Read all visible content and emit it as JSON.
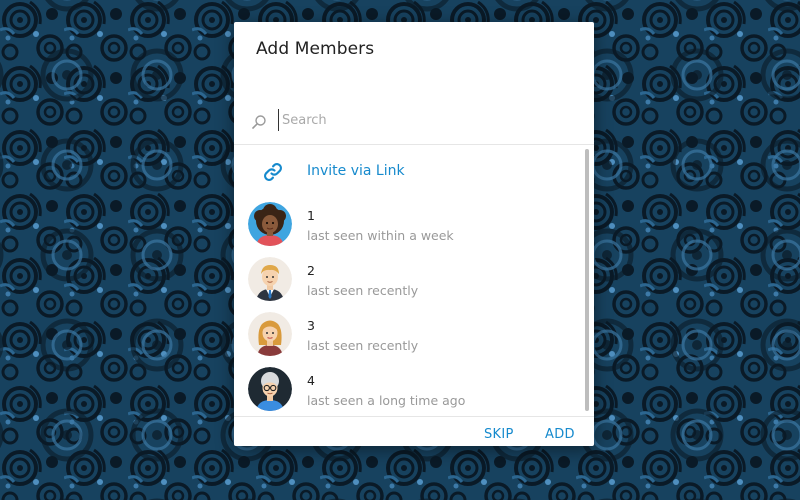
{
  "dialog": {
    "title": "Add Members",
    "search_placeholder": "Search",
    "invite_label": "Invite via Link",
    "skip_label": "SKIP",
    "add_label": "ADD"
  },
  "members": [
    {
      "name": "1",
      "status": "last seen within a week",
      "avatar": "woman-curly-hair-avatar"
    },
    {
      "name": "2",
      "status": "last seen recently",
      "avatar": "man-blonde-tie-avatar"
    },
    {
      "name": "3",
      "status": "last seen recently",
      "avatar": "woman-blonde-avatar"
    },
    {
      "name": "4",
      "status": "last seen a long time ago",
      "avatar": "older-woman-glasses-avatar"
    }
  ],
  "colors": {
    "accent": "#168acd",
    "muted_text": "#999999",
    "backdrop": "#0f2a3f"
  }
}
